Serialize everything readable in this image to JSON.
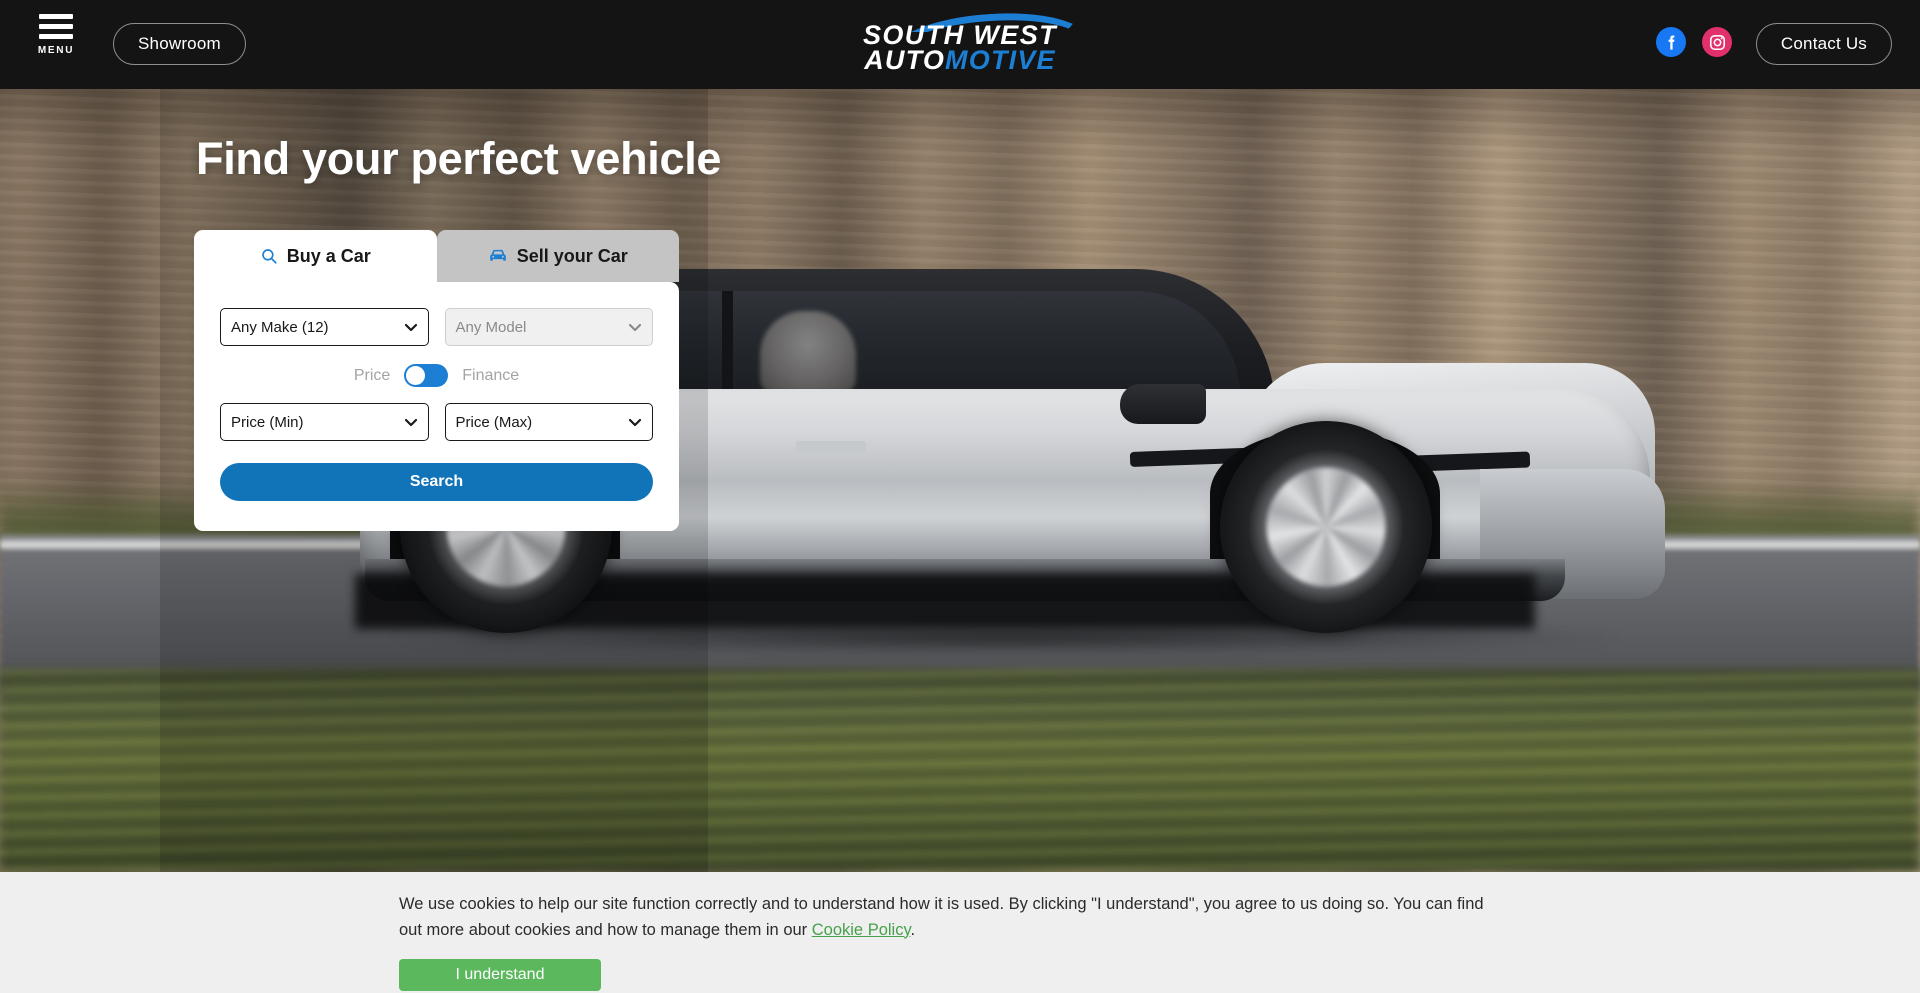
{
  "header": {
    "menu_label": "MENU",
    "showroom_label": "Showroom",
    "contact_label": "Contact Us",
    "logo": {
      "line1": "SOUTH WEST",
      "auto": "AUTO",
      "motive": "MOTIVE"
    },
    "social": {
      "facebook": "f",
      "instagram": ""
    }
  },
  "hero": {
    "title": "Find your perfect vehicle"
  },
  "search_card": {
    "tabs": [
      {
        "label": "Buy a Car",
        "icon": "search-icon",
        "active": true
      },
      {
        "label": "Sell your Car",
        "icon": "car-icon",
        "active": false
      }
    ],
    "make_select": {
      "value": "Any Make (12)",
      "disabled": false
    },
    "model_select": {
      "value": "Any Model",
      "disabled": true
    },
    "toggle": {
      "left_label": "Price",
      "right_label": "Finance",
      "state": "price"
    },
    "price_min_select": {
      "value": "Price (Min)"
    },
    "price_max_select": {
      "value": "Price (Max)"
    },
    "search_label": "Search"
  },
  "cookie_banner": {
    "text_part1": "We use cookies to help our site function correctly and to understand how it is used. By clicking \"I understand\", you agree to us doing so. You can find out more about cookies and how to manage them in our ",
    "link_label": "Cookie Policy",
    "text_part2": ".",
    "button_label": "I understand"
  },
  "colors": {
    "brand_blue": "#1c7fd4",
    "button_blue": "#1174b8",
    "cookie_green": "#5cb85c",
    "link_green": "#47a14a",
    "header_bg": "#141414",
    "facebook_blue": "#1877f2",
    "instagram_pink": "#e1306c"
  }
}
